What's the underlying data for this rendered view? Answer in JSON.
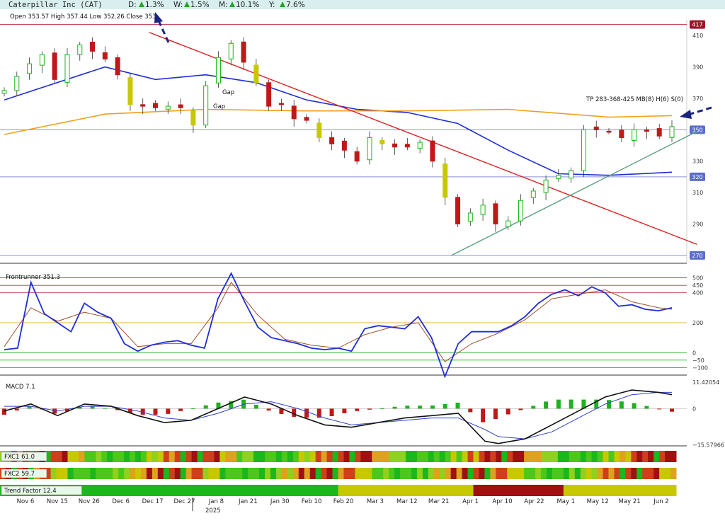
{
  "header": {
    "symbol_title": "Caterpillar Inc (CAT)",
    "changes": [
      {
        "label": "D:",
        "value": "1.3%"
      },
      {
        "label": "W:",
        "value": "1.5%"
      },
      {
        "label": "M:",
        "value": "10.1%"
      },
      {
        "label": "Y:",
        "value": "7.6%"
      }
    ],
    "ohlc_text": "Open 353.57  High 357.44  Low 352.26  Close 353.",
    "bar_color": "#d9efef",
    "up_color": "#22a722"
  },
  "price_panel": {
    "y_ticks": [
      "410",
      "390",
      "370",
      "350",
      "330",
      "310",
      "290",
      "270"
    ],
    "badges": [
      {
        "text": "417",
        "value": 417,
        "color": "#a0142a"
      },
      {
        "text": "350",
        "value": 350,
        "color": "#5b6fc8"
      },
      {
        "text": "320",
        "value": 320,
        "color": "#5b6fc8"
      },
      {
        "text": "270",
        "value": 270,
        "color": "#5b6fc8"
      }
    ],
    "annotations": [
      "Gap",
      "Gap"
    ],
    "pattern_text": "TP 283-368-425 MB(8) H(6) S(0)"
  },
  "frontrunner": {
    "title": "Frontrunner 351.3",
    "y_ticks": [
      "500",
      "450",
      "400",
      "200",
      "0",
      "−50",
      "−100"
    ]
  },
  "macd": {
    "title": "MACD 7.1",
    "y_ticks": [
      "11.42054",
      "0",
      "−15.57966"
    ]
  },
  "strips": [
    {
      "name": "FXC1 61.0"
    },
    {
      "name": "FXC2 59.7"
    },
    {
      "name": "Trend Factor 12.4"
    }
  ],
  "x_axis": {
    "labels": [
      "Nov 6",
      "Nov 15",
      "Nov 26",
      "Dec 6",
      "Dec 17",
      "Dec 27",
      "Jan 8",
      "Jan 21",
      "Jan 30",
      "Feb 10",
      "Feb 20",
      "Mar 3",
      "Mar 12",
      "Mar 21",
      "Apr 1",
      "Apr 10",
      "Apr 22",
      "May 1",
      "May 12",
      "May 21",
      "Jun 2"
    ],
    "year_label": "2025"
  },
  "chart_data": {
    "type": "candlestick",
    "title": "Caterpillar Inc (CAT)",
    "ohlc_last": {
      "open": 353.57,
      "high": 357.44,
      "low": 352.26
    },
    "x": [
      "Nov 6",
      "Nov 15",
      "Nov 26",
      "Dec 6",
      "Dec 17",
      "Dec 27",
      "Jan 8",
      "Jan 21",
      "Jan 30",
      "Feb 10",
      "Feb 20",
      "Mar 3",
      "Mar 12",
      "Mar 21",
      "Apr 1",
      "Apr 10",
      "Apr 22",
      "May 1",
      "May 12",
      "May 21",
      "Jun 2"
    ],
    "close_path": [
      [
        0,
        375
      ],
      [
        1,
        384
      ],
      [
        2,
        392
      ],
      [
        2.5,
        408
      ],
      [
        3,
        398
      ],
      [
        4,
        382
      ],
      [
        5,
        398
      ],
      [
        6,
        404
      ],
      [
        7,
        400
      ],
      [
        8,
        395
      ],
      [
        9,
        385
      ],
      [
        10,
        366
      ],
      [
        11,
        365
      ],
      [
        12,
        364
      ],
      [
        13,
        365
      ],
      [
        14,
        364
      ],
      [
        15,
        353
      ],
      [
        16,
        378
      ],
      [
        17,
        396
      ],
      [
        18,
        405
      ],
      [
        19,
        393
      ],
      [
        20,
        380
      ],
      [
        21,
        365
      ],
      [
        22,
        366
      ],
      [
        23,
        357
      ],
      [
        24,
        356
      ],
      [
        25,
        345
      ],
      [
        26,
        341
      ],
      [
        27,
        337
      ],
      [
        28,
        330
      ],
      [
        29,
        345
      ],
      [
        30,
        341
      ],
      [
        31,
        339
      ],
      [
        32,
        339
      ],
      [
        33,
        342
      ],
      [
        34,
        330
      ],
      [
        35,
        307
      ],
      [
        36,
        290
      ],
      [
        37,
        297
      ],
      [
        38,
        302
      ],
      [
        39,
        290
      ],
      [
        40,
        292
      ],
      [
        41,
        305
      ],
      [
        42,
        311
      ],
      [
        43,
        318
      ],
      [
        44,
        321
      ],
      [
        45,
        324
      ],
      [
        46,
        350
      ],
      [
        47,
        350
      ],
      [
        48,
        349
      ],
      [
        49,
        345
      ],
      [
        50,
        350
      ],
      [
        51,
        349
      ],
      [
        52,
        346
      ],
      [
        53,
        352
      ]
    ],
    "moving_averages": [
      {
        "color": "#1f2ed8",
        "points": [
          [
            0,
            369
          ],
          [
            8,
            390
          ],
          [
            12,
            382
          ],
          [
            16,
            385
          ],
          [
            20,
            380
          ],
          [
            24,
            369
          ],
          [
            28,
            363
          ],
          [
            32,
            361
          ],
          [
            36,
            354
          ],
          [
            40,
            337
          ],
          [
            44,
            322
          ],
          [
            48,
            321
          ],
          [
            53,
            323
          ]
        ]
      },
      {
        "color": "#f0a01e",
        "points": [
          [
            0,
            347
          ],
          [
            8,
            360
          ],
          [
            16,
            363
          ],
          [
            24,
            362
          ],
          [
            32,
            362
          ],
          [
            40,
            363
          ],
          [
            48,
            358
          ],
          [
            53,
            359
          ]
        ]
      }
    ],
    "horizontal_lines": [
      {
        "value": 417,
        "color": "#c03048"
      },
      {
        "value": 350,
        "color": "#8a90d8"
      },
      {
        "value": 320,
        "color": "#8a90d8"
      },
      {
        "value": 270,
        "color": "#8a90d8"
      }
    ],
    "trendlines": [
      {
        "color": "#e02020",
        "from": [
          11.5,
          412
        ],
        "to": [
          55,
          277
        ]
      },
      {
        "color": "#5aa080",
        "from": [
          35.5,
          270
        ],
        "to": [
          55,
          349
        ]
      }
    ],
    "ylim": [
      265,
      420
    ],
    "frontrunner_ylim": [
      -150,
      550
    ],
    "frontrunner_line": [
      [
        0,
        20
      ],
      [
        1,
        30
      ],
      [
        2,
        470
      ],
      [
        3,
        260
      ],
      [
        4,
        200
      ],
      [
        5,
        140
      ],
      [
        6,
        330
      ],
      [
        7,
        270
      ],
      [
        8,
        230
      ],
      [
        9,
        60
      ],
      [
        10,
        10
      ],
      [
        11,
        50
      ],
      [
        12,
        70
      ],
      [
        13,
        80
      ],
      [
        14,
        50
      ],
      [
        15,
        30
      ],
      [
        16,
        360
      ],
      [
        17,
        530
      ],
      [
        18,
        340
      ],
      [
        19,
        170
      ],
      [
        20,
        100
      ],
      [
        21,
        80
      ],
      [
        22,
        60
      ],
      [
        23,
        30
      ],
      [
        24,
        20
      ],
      [
        25,
        30
      ],
      [
        26,
        10
      ],
      [
        27,
        160
      ],
      [
        28,
        180
      ],
      [
        29,
        170
      ],
      [
        30,
        160
      ],
      [
        31,
        240
      ],
      [
        32,
        100
      ],
      [
        33,
        -160
      ],
      [
        34,
        60
      ],
      [
        35,
        140
      ],
      [
        36,
        140
      ],
      [
        37,
        140
      ],
      [
        38,
        180
      ],
      [
        39,
        240
      ],
      [
        40,
        330
      ],
      [
        41,
        390
      ],
      [
        42,
        420
      ],
      [
        43,
        380
      ],
      [
        44,
        440
      ],
      [
        45,
        400
      ],
      [
        46,
        310
      ],
      [
        47,
        320
      ],
      [
        48,
        290
      ],
      [
        49,
        280
      ],
      [
        50,
        300
      ]
    ],
    "frontrunner_signal": [
      [
        0,
        40
      ],
      [
        2,
        300
      ],
      [
        4,
        210
      ],
      [
        6,
        270
      ],
      [
        8,
        230
      ],
      [
        10,
        40
      ],
      [
        12,
        60
      ],
      [
        14,
        60
      ],
      [
        16,
        300
      ],
      [
        17,
        470
      ],
      [
        19,
        250
      ],
      [
        21,
        90
      ],
      [
        23,
        50
      ],
      [
        25,
        30
      ],
      [
        27,
        120
      ],
      [
        29,
        170
      ],
      [
        31,
        200
      ],
      [
        33,
        -60
      ],
      [
        35,
        60
      ],
      [
        37,
        130
      ],
      [
        39,
        220
      ],
      [
        41,
        360
      ],
      [
        43,
        390
      ],
      [
        45,
        420
      ],
      [
        47,
        340
      ],
      [
        49,
        300
      ],
      [
        50,
        290
      ]
    ],
    "macd_ylim": [
      -16,
      12
    ],
    "macd_line": [
      [
        0,
        -1
      ],
      [
        2,
        2
      ],
      [
        4,
        -3
      ],
      [
        6,
        2
      ],
      [
        8,
        1
      ],
      [
        10,
        -3
      ],
      [
        12,
        -6
      ],
      [
        14,
        -5
      ],
      [
        16,
        0
      ],
      [
        18,
        5
      ],
      [
        20,
        2
      ],
      [
        22,
        -3
      ],
      [
        24,
        -7
      ],
      [
        26,
        -8
      ],
      [
        28,
        -6
      ],
      [
        30,
        -4
      ],
      [
        32,
        -3
      ],
      [
        34,
        -2
      ],
      [
        36,
        -14
      ],
      [
        37,
        -15
      ],
      [
        39,
        -13
      ],
      [
        41,
        -7
      ],
      [
        43,
        -1
      ],
      [
        45,
        5
      ],
      [
        47,
        8
      ],
      [
        49,
        7
      ],
      [
        50,
        6
      ]
    ],
    "macd_signal": [
      [
        0,
        1
      ],
      [
        2,
        1
      ],
      [
        4,
        -1
      ],
      [
        6,
        1
      ],
      [
        8,
        1
      ],
      [
        10,
        -1
      ],
      [
        12,
        -4
      ],
      [
        14,
        -5
      ],
      [
        16,
        -2
      ],
      [
        18,
        2
      ],
      [
        20,
        3
      ],
      [
        22,
        0
      ],
      [
        24,
        -4
      ],
      [
        26,
        -7
      ],
      [
        28,
        -6
      ],
      [
        30,
        -5
      ],
      [
        32,
        -4
      ],
      [
        34,
        -4
      ],
      [
        36,
        -9
      ],
      [
        37,
        -12
      ],
      [
        39,
        -13
      ],
      [
        41,
        -10
      ],
      [
        43,
        -4
      ],
      [
        45,
        2
      ],
      [
        47,
        6
      ],
      [
        49,
        7
      ],
      [
        50,
        7
      ]
    ]
  }
}
